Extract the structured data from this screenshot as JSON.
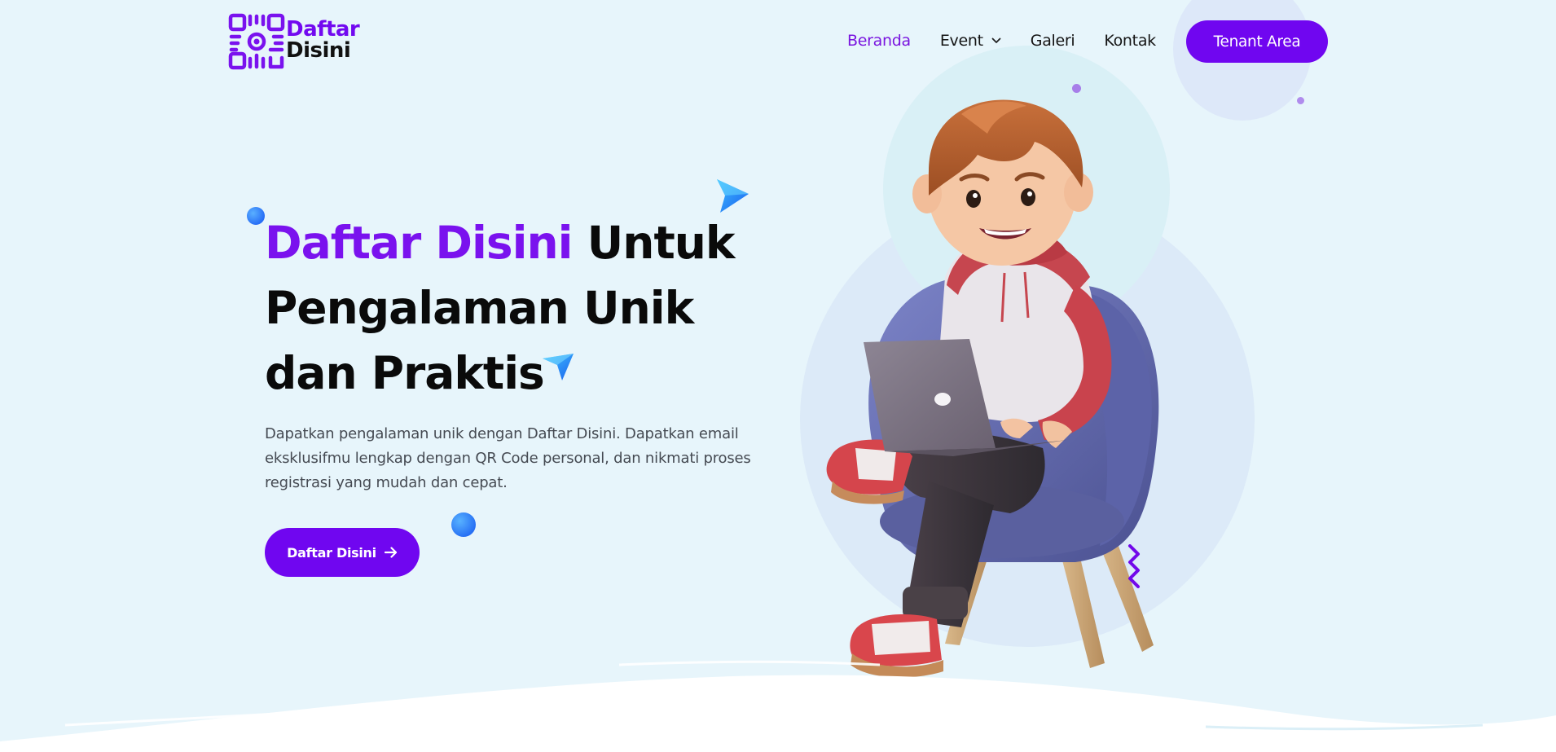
{
  "brand": {
    "name_line1": "Daftar",
    "name_line2": "Disini",
    "logo_icon": "qr-code-icon",
    "accent_color": "#7006f0"
  },
  "nav": {
    "items": [
      {
        "label": "Beranda",
        "active": true
      },
      {
        "label": "Event",
        "has_dropdown": true
      },
      {
        "label": "Galeri"
      },
      {
        "label": "Kontak"
      }
    ],
    "cta_label": "Tenant Area"
  },
  "hero": {
    "title_accent": "Daftar Disini",
    "title_rest_line1": " Untuk",
    "title_line2": "Pengalaman Unik",
    "title_line3": "dan Praktis",
    "description_lines": [
      "Dapatkan pengalaman unik dengan Daftar Disini. Dapatkan email",
      "eksklusifmu lengkap dengan QR Code personal, dan nikmati proses",
      "registrasi yang  mudah dan cepat."
    ],
    "cta_label": "Daftar Disini",
    "cta_icon": "arrow-right-icon"
  },
  "colors": {
    "background": "#e7f5fb",
    "primary": "#7006f0",
    "accent_text": "#7a12ee",
    "dot_blue": "#1456f0"
  }
}
